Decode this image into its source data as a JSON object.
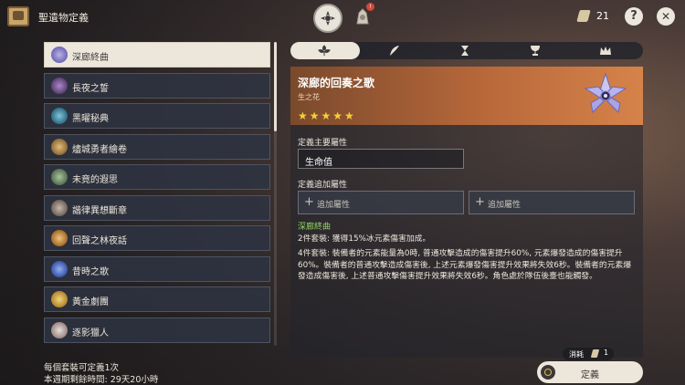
{
  "header": {
    "title": "聖遺物定義",
    "currency_value": "21",
    "tab_badge": "!",
    "help_label": "?",
    "close_label": "✕"
  },
  "set_list": [
    {
      "label": "深廊終曲",
      "icon_color": "#7d76c7",
      "selected": true
    },
    {
      "label": "長夜之誓",
      "icon_color": "#6e4f8c"
    },
    {
      "label": "黑曜秘典",
      "icon_color": "#3a7f97"
    },
    {
      "label": "燼城勇者繪卷",
      "icon_color": "#b68a4a"
    },
    {
      "label": "未竟的遐思",
      "icon_color": "#6f8c6a"
    },
    {
      "label": "諧律異想斷章",
      "icon_color": "#8a7a6e"
    },
    {
      "label": "回聲之林夜話",
      "icon_color": "#c48a3c"
    },
    {
      "label": "昔時之歌",
      "icon_color": "#4d6fc7"
    },
    {
      "label": "黃金劇團",
      "icon_color": "#d0a23e"
    },
    {
      "label": "逐影獵人",
      "icon_color": "#b9a5a0"
    }
  ],
  "footer_notes": {
    "line1": "每個套裝可定義1次",
    "line2": "本週期剩餘時間: 29天20小時"
  },
  "artifact": {
    "name": "深廊的回奏之歌",
    "slot": "生之花",
    "stars": "★★★★★",
    "main_stat_heading": "定義主要屬性",
    "main_stat": "生命值",
    "sub_stat_heading": "定義追加屬性",
    "sub_stat_placeholder_1": "追加屬性",
    "sub_stat_placeholder_2": "追加屬性",
    "add_glyph": "+",
    "set_name": "深廊終曲",
    "set_bonus_2": "2件套裝: 獲得15%冰元素傷害加成。",
    "set_bonus_4": "4件套裝: 裝備者的元素能量為0時, 普通攻擊造成的傷害提升60%, 元素爆發造成的傷害提升60%。裝備者的普通攻擊造成傷害後, 上述元素爆發傷害提升效果將失效6秒。裝備者的元素爆發造成傷害後, 上述普通攻擊傷害提升效果將失效6秒。角色處於隊伍後臺也能觸發。"
  },
  "action": {
    "cost_label": "消耗",
    "cost_value": "1",
    "confirm_label": "定義"
  }
}
